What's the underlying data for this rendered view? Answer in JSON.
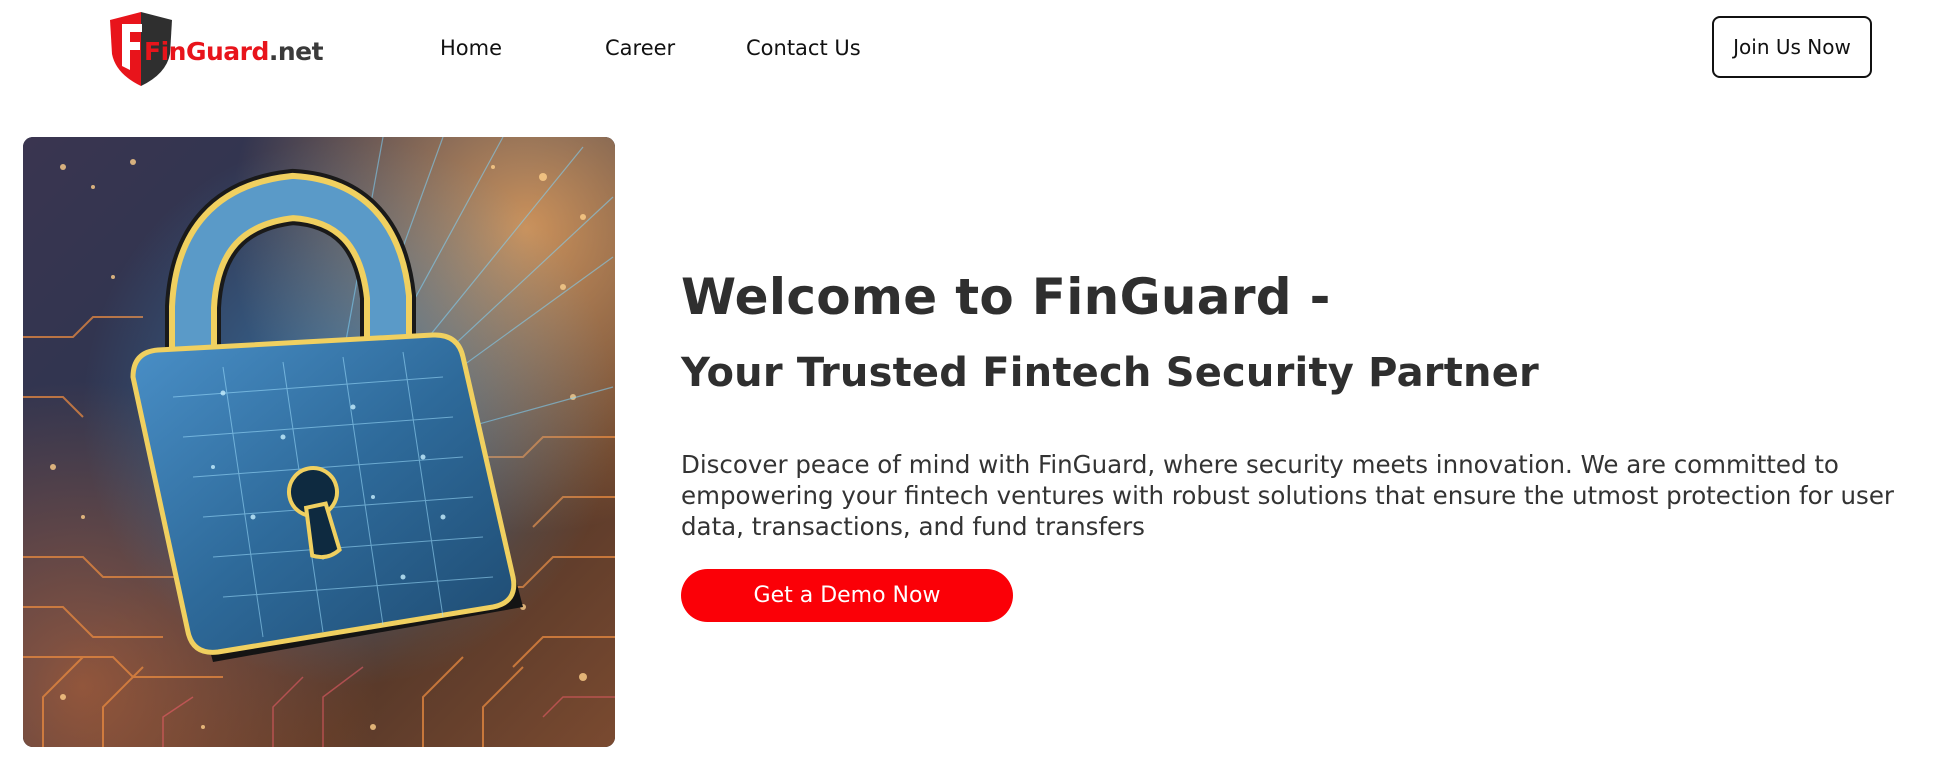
{
  "header": {
    "logo": {
      "brand_text": "FinGuard",
      "tld_text": ".net",
      "icon": "finguard-shield-logo"
    },
    "nav": [
      {
        "label": "Home"
      },
      {
        "label": "Career"
      },
      {
        "label": "Contact Us"
      }
    ],
    "join_button_label": "Join Us Now"
  },
  "hero": {
    "image": {
      "icon": "padlock-circuit-illustration"
    },
    "title": "Welcome to FinGuard -",
    "subtitle": "Your Trusted Fintech Security Partner",
    "description": "Discover peace of mind with FinGuard, where security meets innovation. We are committed to empowering your fintech ventures with robust solutions that ensure the utmost protection for user data, transactions, and fund transfers",
    "cta_label": "Get a Demo Now"
  },
  "colors": {
    "brand_red": "#fb0007",
    "logo_red": "#e8141b",
    "text_dark": "#2f2f2f",
    "button_border": "#111111"
  }
}
